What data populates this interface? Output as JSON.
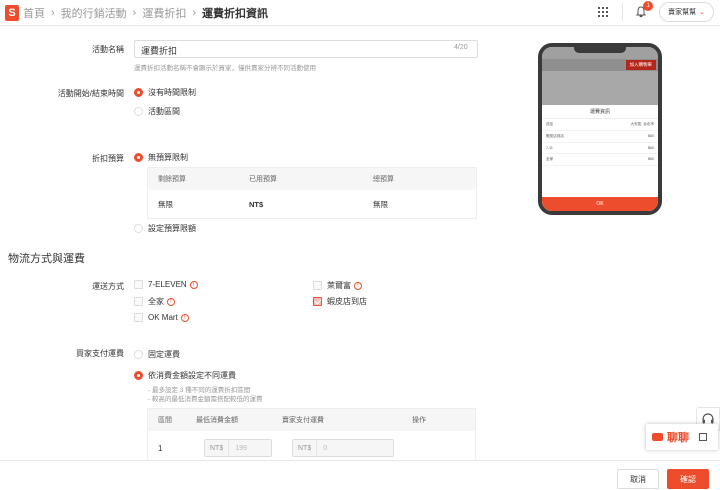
{
  "topbar": {
    "breadcrumbs": [
      "首頁",
      "我的行銷活動",
      "運費折扣",
      "運費折扣資訊"
    ],
    "notification_count": "1",
    "help_label": "賣家幫幫"
  },
  "form": {
    "name_label": "活動名稱",
    "name_value": "運費折扣",
    "name_count": "4/20",
    "name_hint": "運費折扣活動名稱不會顯示於買家，僅供賣家分辨不同活動使用",
    "period_label": "活動開始/結束時間",
    "period_opt_none": "沒有時間限制",
    "period_opt_range": "活動區間",
    "budget_label": "折扣預算",
    "budget_opt_unlimited": "無預算限制",
    "budget_opt_set": "設定預算限額",
    "budget_table": {
      "headers": [
        "剩餘預算",
        "已用預算",
        "總預算"
      ],
      "row": [
        "無限",
        "NT$",
        "無限"
      ]
    }
  },
  "shipping": {
    "section_title": "物流方式與運費",
    "methods_label": "運送方式",
    "methods": [
      {
        "name": "7-ELEVEN",
        "checked": false,
        "warning": true
      },
      {
        "name": "萊爾富",
        "checked": false,
        "warning": true
      },
      {
        "name": "全家",
        "checked": false,
        "warning": true
      },
      {
        "name": "蝦皮店到店",
        "checked": true,
        "warning": false
      },
      {
        "name": "OK Mart",
        "checked": false,
        "warning": true
      }
    ],
    "buyer_fee_label": "買家支付運費",
    "fee_opt_fixed": "固定運費",
    "fee_opt_tier": "依消費金額設定不同運費",
    "tier_hint_1": "- 最多設定 3 種不同的運費折扣區間",
    "tier_hint_2": "- 較高的最低消費金額需搭配較低的運費",
    "tier_table": {
      "headers": [
        "區間",
        "最低消費金額",
        "賣家支付運費",
        "操作"
      ],
      "row": {
        "index": "1",
        "min_prefix": "NT$",
        "min_placeholder": "199",
        "fee_prefix": "NT$",
        "fee_placeholder": "0"
      }
    }
  },
  "preview": {
    "buy_now": "加入購物車",
    "sheet_title": "運費資訊",
    "lines": [
      {
        "left": "送至",
        "right": "大安區, 台北市"
      },
      {
        "left": "蝦皮店到店",
        "right": "$60"
      },
      {
        "left": "7-11",
        "right": "$60"
      },
      {
        "left": "全家",
        "right": "$60"
      }
    ],
    "ok": "OK"
  },
  "chat": {
    "label": "聊聊"
  },
  "footer": {
    "cancel": "取消",
    "confirm": "確認"
  },
  "colors": {
    "accent": "#ee4d2d"
  }
}
